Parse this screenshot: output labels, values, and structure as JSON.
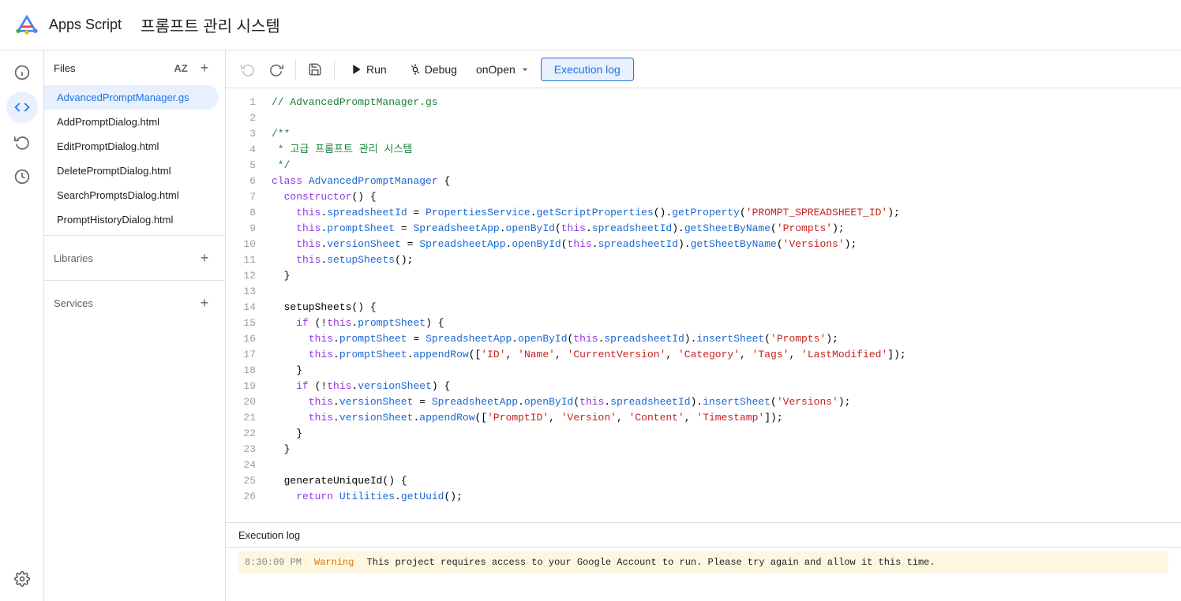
{
  "header": {
    "app_name": "Apps Script",
    "project_title": "프롬프트 관리 시스템"
  },
  "toolbar": {
    "run_label": "Run",
    "debug_label": "Debug",
    "function_name": "onOpen",
    "execution_log_label": "Execution log"
  },
  "sidebar": {
    "files_label": "Files",
    "libraries_label": "Libraries",
    "services_label": "Services",
    "files": [
      {
        "name": "AdvancedPromptManager.gs",
        "active": true
      },
      {
        "name": "AddPromptDialog.html",
        "active": false
      },
      {
        "name": "EditPromptDialog.html",
        "active": false
      },
      {
        "name": "DeletePromptDialog.html",
        "active": false
      },
      {
        "name": "SearchPromptsDialog.html",
        "active": false
      },
      {
        "name": "PromptHistoryDialog.html",
        "active": false
      }
    ]
  },
  "code": {
    "lines": [
      {
        "n": 1,
        "text": "// AdvancedPromptManager.gs"
      },
      {
        "n": 2,
        "text": ""
      },
      {
        "n": 3,
        "text": "/**"
      },
      {
        "n": 4,
        "text": " * 고급 프롬프트 관리 시스템"
      },
      {
        "n": 5,
        "text": " */"
      },
      {
        "n": 6,
        "text": "class AdvancedPromptManager {"
      },
      {
        "n": 7,
        "text": "  constructor() {"
      },
      {
        "n": 8,
        "text": "    this.spreadsheetId = PropertiesService.getScriptProperties().getProperty('PROMPT_SPREADSHEET_ID');"
      },
      {
        "n": 9,
        "text": "    this.promptSheet = SpreadsheetApp.openById(this.spreadsheetId).getSheetByName('Prompts');"
      },
      {
        "n": 10,
        "text": "    this.versionSheet = SpreadsheetApp.openById(this.spreadsheetId).getSheetByName('Versions');"
      },
      {
        "n": 11,
        "text": "    this.setupSheets();"
      },
      {
        "n": 12,
        "text": "  }"
      },
      {
        "n": 13,
        "text": ""
      },
      {
        "n": 14,
        "text": "  setupSheets() {"
      },
      {
        "n": 15,
        "text": "    if (!this.promptSheet) {"
      },
      {
        "n": 16,
        "text": "      this.promptSheet = SpreadsheetApp.openById(this.spreadsheetId).insertSheet('Prompts');"
      },
      {
        "n": 17,
        "text": "      this.promptSheet.appendRow(['ID', 'Name', 'CurrentVersion', 'Category', 'Tags', 'LastModified']);"
      },
      {
        "n": 18,
        "text": "    }"
      },
      {
        "n": 19,
        "text": "    if (!this.versionSheet) {"
      },
      {
        "n": 20,
        "text": "      this.versionSheet = SpreadsheetApp.openById(this.spreadsheetId).insertSheet('Versions');"
      },
      {
        "n": 21,
        "text": "      this.versionSheet.appendRow(['PromptID', 'Version', 'Content', 'Timestamp']);"
      },
      {
        "n": 22,
        "text": "    }"
      },
      {
        "n": 23,
        "text": "  }"
      },
      {
        "n": 24,
        "text": ""
      },
      {
        "n": 25,
        "text": "  generateUniqueId() {"
      },
      {
        "n": 26,
        "text": "    return Utilities.getUuid();"
      }
    ]
  },
  "execution_log": {
    "title": "Execution log",
    "entries": [
      {
        "time": "8:30:09 PM",
        "level": "Warning",
        "message": "This project requires access to your Google Account to run. Please try again and allow it this time."
      }
    ]
  },
  "icons": {
    "info": "ℹ",
    "code": "⟨⟩",
    "history": "↺",
    "clock": "◷",
    "run_icon": "▶",
    "debug_icon": "⊙",
    "undo": "↩",
    "redo": "↪",
    "save": "⊟",
    "add": "+",
    "dropdown": "▾",
    "az": "AZ"
  }
}
